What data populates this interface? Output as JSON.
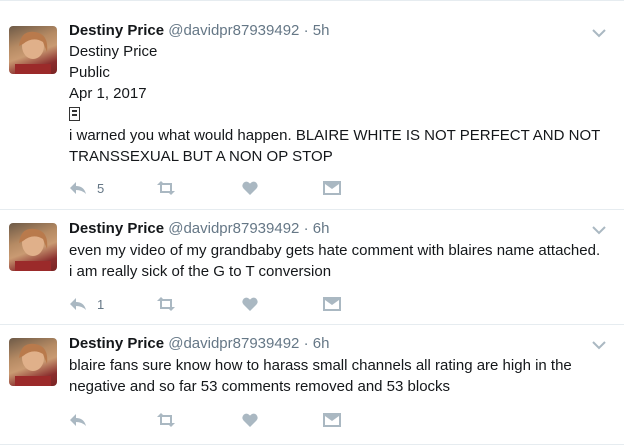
{
  "tweets": [
    {
      "author_name": "Destiny Price",
      "handle": "@davidpr87939492",
      "time": "5h",
      "lines": [
        "Destiny Price",
        "Public",
        "Apr 1, 2017",
        "i warned you what would happen.  BLAIRE  WHITE IS NOT PERFECT AND NOT TRANSSEXUAL BUT A NON OP  STOP"
      ],
      "reply_count": "5"
    },
    {
      "author_name": "Destiny Price",
      "handle": "@davidpr87939492",
      "time": "6h",
      "text": "even my video of my grandbaby gets hate comment with blaires name attached. i am really sick of the G to T conversion",
      "reply_count": "1"
    },
    {
      "author_name": "Destiny Price",
      "handle": "@davidpr87939492",
      "time": "6h",
      "text": "blaire fans sure know how to harass small channels all rating are high in the negative and so far 53 comments removed and 53 blocks",
      "reply_count": ""
    }
  ],
  "colors": {
    "text": "#14171a",
    "meta": "#657786",
    "icon": "#aab8c2",
    "divider": "#e6ecf0"
  },
  "icons": [
    "reply-icon",
    "retweet-icon",
    "like-icon",
    "direct-message-icon",
    "chevron-down-icon",
    "flag-icon"
  ]
}
